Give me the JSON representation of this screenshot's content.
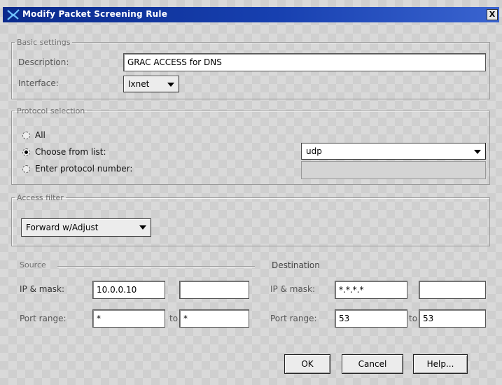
{
  "window": {
    "title": "Modify Packet Screening Rule",
    "close_label": "X"
  },
  "basic": {
    "legend": "Basic settings",
    "description_label": "Description:",
    "description_value": "GRAC ACCESS for DNS",
    "interface_label": "Interface:",
    "interface_value": "Ixnet"
  },
  "protocol": {
    "legend": "Protocol selection",
    "options": [
      {
        "label": "All",
        "checked": false
      },
      {
        "label": "Choose from list:",
        "checked": true
      },
      {
        "label": "Enter protocol number:",
        "checked": false
      }
    ],
    "list_value": "udp",
    "number_value": ""
  },
  "access": {
    "legend": "Access filter",
    "value": "Forward w/Adjust"
  },
  "source": {
    "legend": "Source",
    "ip_label": "IP & mask:",
    "ip_value": "10.0.0.10",
    "mask_value": "",
    "port_label": "Port range:",
    "port_from": "*",
    "to_label": "to",
    "port_to": "*"
  },
  "destination": {
    "legend": "Destination",
    "ip_label": "IP & mask:",
    "ip_value": "*.*.*.*",
    "mask_value": "",
    "port_label": "Port range:",
    "port_from": "53",
    "to_label": "to",
    "port_to": "53"
  },
  "buttons": {
    "ok": "OK",
    "cancel": "Cancel",
    "help": "Help..."
  }
}
